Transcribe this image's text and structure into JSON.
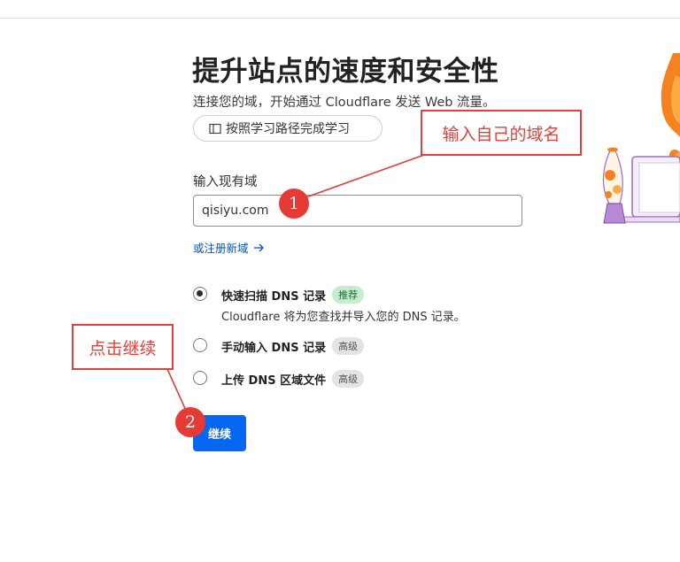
{
  "header": {
    "title": "提升站点的速度和安全性",
    "subtitle": "连接您的域，开始通过 Cloudflare 发送 Web 流量。",
    "learning_path_button": "按照学习路径完成学习"
  },
  "domain_form": {
    "label": "输入现有域",
    "value": "qisiyu.com",
    "register_link": "或注册新域"
  },
  "dns_options": [
    {
      "title": "快速扫描 DNS 记录",
      "badge": "推荐",
      "description": "Cloudflare 将为您查找并导入您的 DNS 记录。",
      "selected": true
    },
    {
      "title": "手动输入 DNS 记录",
      "badge": "高级",
      "selected": false
    },
    {
      "title": "上传 DNS 区域文件",
      "badge": "高级",
      "selected": false
    }
  ],
  "continue_button": "继续",
  "annotations": {
    "box_1": "输入自己的域名",
    "box_2": "点击继续",
    "marker_1": "1",
    "marker_2": "2"
  },
  "colors": {
    "accent": "#0567ef",
    "link": "#0051c3",
    "annotation": "#e0413a",
    "badge_recommended": "#c4ecd0",
    "badge_advanced": "#e3e3e3"
  }
}
